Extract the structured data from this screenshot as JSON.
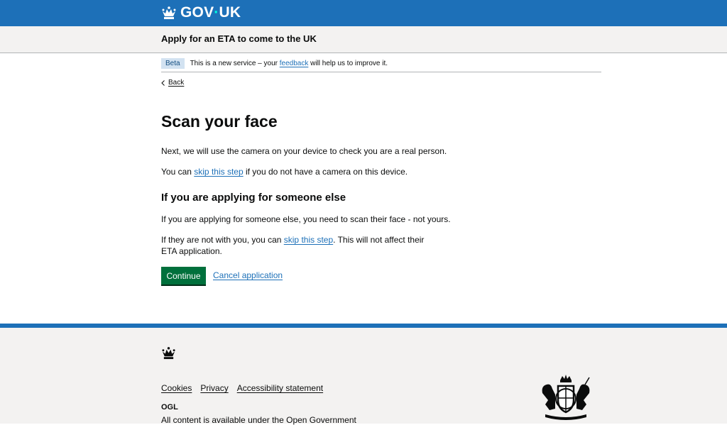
{
  "header": {
    "logo_text_a": "GOV",
    "logo_dot": "·",
    "logo_text_b": "UK",
    "service_name": "Apply for an ETA to come to the UK"
  },
  "phase_banner": {
    "tag": "Beta",
    "text_before": "This is a new service – your ",
    "link": "feedback",
    "text_after": " will help us to improve it."
  },
  "back_link": "Back",
  "main": {
    "heading": "Scan your face",
    "intro": "Next, we will use the camera on your device to check you are a real person.",
    "skip_line_before": "You can ",
    "skip_link": "skip this step",
    "skip_line_after": " if you do not have a camera on this device.",
    "subheading": "If you are applying for someone else",
    "someone_else_text": "If you are applying for someone else, you need to scan their face - not yours.",
    "not_with_before": "If they are not with you, you can ",
    "not_with_link": "skip this step",
    "not_with_after": ". This will not affect their ETA application.",
    "continue_button": "Continue",
    "cancel_link": "Cancel application"
  },
  "footer": {
    "links": [
      "Cookies",
      "Privacy",
      "Accessibility statement"
    ],
    "ogl_label": "OGL",
    "licence_text": "All content is available under the Open Government"
  },
  "colors": {
    "brand_blue": "#1d70b8",
    "button_green": "#00703c",
    "footer_bg": "#f3f2f1"
  },
  "icons": [
    "crown-icon",
    "back-chevron-icon",
    "ogl-logo",
    "royal-coat-of-arms"
  ]
}
